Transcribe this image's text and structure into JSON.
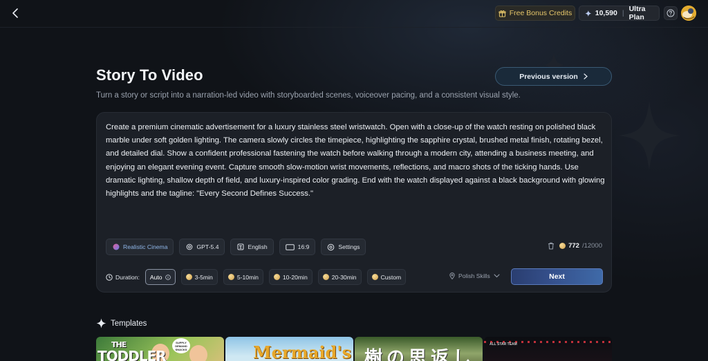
{
  "topbar": {
    "bonus_label": "Free Bonus Credits",
    "credits": "10,590",
    "plan": "Ultra Plan"
  },
  "header": {
    "title": "Story To Video",
    "subtitle": "Turn a story or script into a narration-led video with storyboarded scenes, voiceover pacing, and a consistent visual style.",
    "prev_version": "Previous version"
  },
  "editor": {
    "prompt": "Create a premium cinematic advertisement for a luxury stainless steel wristwatch. Open with a close-up of the watch resting on polished black marble under soft golden lighting. The camera slowly circles the timepiece, highlighting the sapphire crystal, brushed metal finish, rotating bezel, and detailed dial. Show a confident professional fastening the watch before walking through a modern city, attending a business meeting, and enjoying an elegant evening event. Capture smooth slow-motion wrist movements, reflections, and macro shots of the ticking hands. Use dramatic lighting, shallow depth of field, and luxury-inspired color grading. End with the watch displayed against a black background with glowing highlights and the tagline: \"Every Second Defines Success.\"",
    "chips": {
      "style": "Realistic Cinema",
      "model": "GPT-5.4",
      "language": "English",
      "ratio": "16:9",
      "settings": "Settings"
    },
    "counter": {
      "count": "772",
      "total": "/12000"
    },
    "duration": {
      "label": "Duration:",
      "options": [
        "Auto",
        "3-5min",
        "5-10min",
        "10-20min",
        "20-30min",
        "Custom"
      ],
      "selected": "Auto"
    },
    "polish": "Polish Skills",
    "next": "Next"
  },
  "templates": {
    "heading": "Templates",
    "items": [
      {
        "text_small": "THE",
        "text": "TODDLER",
        "bubble": "SUPPLY DEMAND SNACKS"
      },
      {
        "text": "Mermaid's"
      },
      {
        "text": "樹の思返し"
      },
      {
        "text": "ALL STAR TEAM"
      }
    ]
  },
  "colors": {
    "background": "#101318",
    "card": "#1c2027",
    "accent_gold": "#e6c66a",
    "next_button": "#35508c",
    "style_chip_text": "#8fb6e8"
  }
}
